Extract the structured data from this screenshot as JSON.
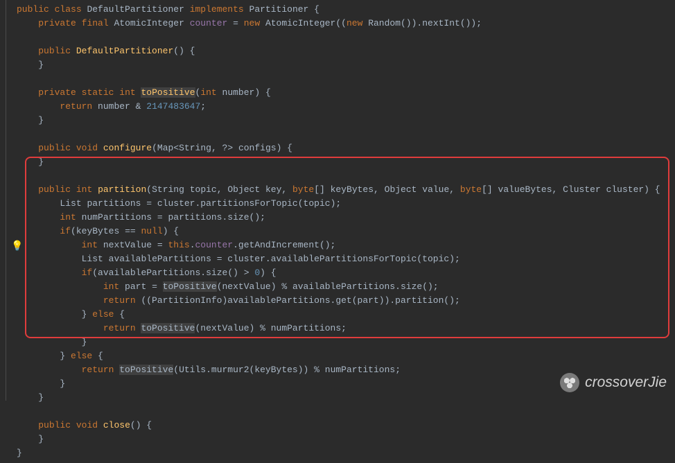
{
  "code": {
    "kw_public": "public",
    "kw_class": "class",
    "kw_implements": "implements",
    "kw_private": "private",
    "kw_final": "final",
    "kw_static": "static",
    "kw_int": "int",
    "kw_void": "void",
    "kw_new": "new",
    "kw_return": "return",
    "kw_this": "this",
    "kw_if": "if",
    "kw_else": "else",
    "kw_null": "null",
    "kw_byte": "byte",
    "classname": "DefaultPartitioner",
    "iface": "Partitioner",
    "atomic_int": "AtomicInteger",
    "field_counter": "counter",
    "random": "Random",
    "nextInt": "nextInt",
    "ctor": "DefaultPartitioner",
    "m_toPositive": "toPositive",
    "p_number": "number",
    "num_maxpos": "2147483647",
    "m_configure": "configure",
    "t_map": "Map",
    "t_string": "String",
    "p_configs": "configs",
    "m_partition": "partition",
    "p_topic": "topic",
    "t_object": "Object",
    "p_key": "key",
    "p_keyBytes": "keyBytes",
    "p_value": "value",
    "p_valueBytes": "valueBytes",
    "t_cluster": "Cluster",
    "p_cluster": "cluster",
    "t_list": "List",
    "v_partitions": "partitions",
    "m_partitionsForTopic": "partitionsForTopic",
    "v_numPartitions": "numPartitions",
    "m_size": "size",
    "v_nextValue": "nextValue",
    "m_getAndIncrement": "getAndIncrement",
    "v_availablePartitions": "availablePartitions",
    "m_availablePartitionsForTopic": "availablePartitionsForTopic",
    "num_zero": "0",
    "v_part": "part",
    "t_partitionInfo": "PartitionInfo",
    "m_get": "get",
    "m_partition2": "partition",
    "t_utils": "Utils",
    "m_murmur2": "murmur2",
    "m_close": "close"
  },
  "watermark": {
    "text": "crossoverJie"
  }
}
